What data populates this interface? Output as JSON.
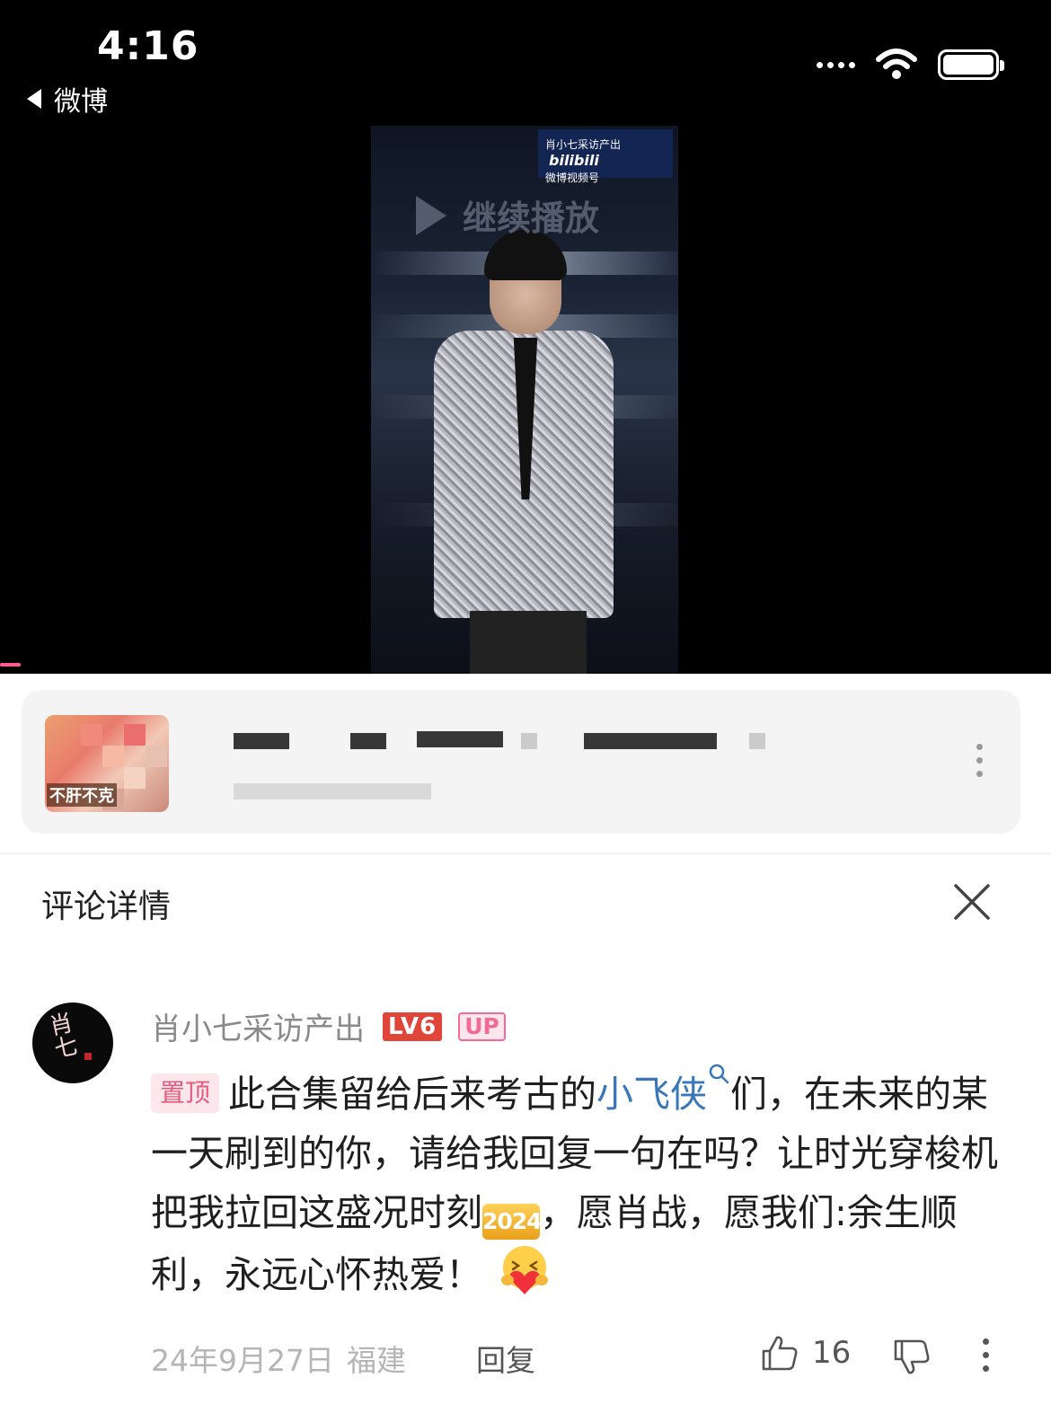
{
  "status_bar": {
    "time": "4:16",
    "back_app": "微博"
  },
  "video": {
    "watermark_line1": "肖小七采访产出",
    "watermark_brand": "bilibili",
    "watermark_line2": "微博视频号",
    "continue_label": "继续播放",
    "progress": 0.02
  },
  "user_card": {
    "avatar_text": "不肝不克"
  },
  "comment_detail": {
    "title": "评论详情",
    "comment": {
      "author": "肖小七采访产出",
      "level_badge": "LV6",
      "up_badge": "UP",
      "pin_tag": "置顶",
      "text_part1": "此合集留给后来考古的",
      "topic": "小飞侠",
      "text_part2": "们，在未来的某一天刷到的你，请给我回复一句在吗？让时光穿梭机把我拉回这盛况时刻",
      "emoji_2024": "2024",
      "text_part3": "，愿肖战，愿我们:余生顺利，永远心怀热爱！",
      "date": "24年9月27日",
      "location": "福建",
      "reply_label": "回复",
      "like_count": "16"
    }
  },
  "colors": {
    "accent_pink": "#f16b95",
    "link_blue": "#3a77b8",
    "level_red": "#e0453a"
  }
}
